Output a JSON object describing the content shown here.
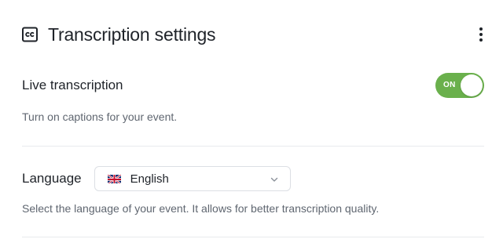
{
  "header": {
    "title": "Transcription settings",
    "icon": "closed-captions-icon",
    "menu_icon": "more-vertical-icon"
  },
  "live_transcription": {
    "label": "Live transcription",
    "toggle_state": "ON",
    "enabled": true,
    "description": "Turn on captions for your event."
  },
  "language": {
    "label": "Language",
    "selected_value": "English",
    "flag_icon": "uk-flag-icon",
    "dropdown_icon": "chevron-down-icon",
    "description": "Select the language of your event. It allows for better transcription quality."
  },
  "colors": {
    "toggle_on": "#6ab04c",
    "text_primary": "#1f2329",
    "text_secondary": "#5f6670",
    "divider": "#e8eaed"
  }
}
